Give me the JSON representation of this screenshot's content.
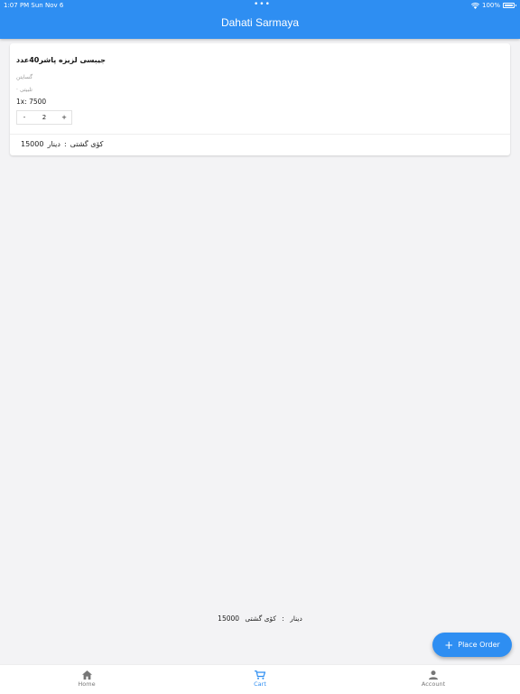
{
  "status_bar": {
    "time": "1:07 PM   Sun Nov 6",
    "dots": "•••",
    "battery": "100%"
  },
  "app": {
    "title": "Dahati Sarmaya"
  },
  "cart": {
    "item": {
      "name": "جیبسی لزیزه پاشر40عدد",
      "sub1": "گسایتن",
      "sub2": "· تلبیتی",
      "price": "1x: 7500",
      "quantity": "2",
      "minus": "-",
      "plus": "+"
    },
    "card_total": {
      "label": "کۆی گشتی",
      "separator": ":",
      "currency": "دینار",
      "amount": "15000"
    }
  },
  "footer_total": {
    "label": "کۆی گشتی",
    "separator": ":",
    "currency": "دینار",
    "amount": "15000"
  },
  "fab": {
    "icon": "plus-icon",
    "label": "Place Order"
  },
  "bottom_nav": {
    "items": [
      {
        "label": "Home",
        "icon": "home-icon"
      },
      {
        "label": "Cart",
        "icon": "cart-icon",
        "active": true
      },
      {
        "label": "Account",
        "icon": "account-icon"
      }
    ]
  },
  "colors": {
    "primary": "#2e8ef2",
    "background": "#f3f3f5",
    "inactive": "#777777"
  }
}
